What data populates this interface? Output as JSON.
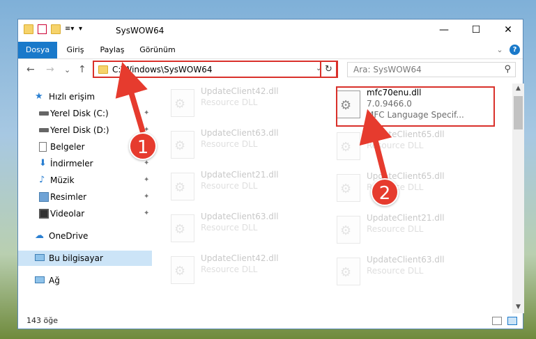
{
  "window": {
    "title": "SysWOW64",
    "minimize_glyph": "—",
    "maximize_glyph": "☐",
    "close_glyph": "✕"
  },
  "ribbon": {
    "tabs": [
      "Dosya",
      "Giriş",
      "Paylaş",
      "Görünüm"
    ],
    "expand_glyph": "⌄",
    "help_glyph": "?"
  },
  "nav": {
    "back_glyph": "←",
    "forward_glyph": "→",
    "recent_glyph": "⌄",
    "up_glyph": "↑",
    "address": "C:\\Windows\\SysWOW64",
    "address_dropdown_glyph": "⌄",
    "refresh_glyph": "↻",
    "search_placeholder": "Ara: SysWOW64",
    "search_glyph": "⚲"
  },
  "sidebar": {
    "items": [
      {
        "label": "Hızlı erişim",
        "icon": "star-icon"
      },
      {
        "label": "Yerel Disk (C:)",
        "icon": "drive-icon",
        "pinned": true
      },
      {
        "label": "Yerel Disk (D:)",
        "icon": "drive-icon",
        "pinned": true
      },
      {
        "label": "Belgeler",
        "icon": "documents-icon",
        "pinned": true
      },
      {
        "label": "İndirmeler",
        "icon": "download-icon",
        "pinned": true
      },
      {
        "label": "Müzik",
        "icon": "music-icon",
        "pinned": true
      },
      {
        "label": "Resimler",
        "icon": "pictures-icon",
        "pinned": true
      },
      {
        "label": "Videolar",
        "icon": "videos-icon",
        "pinned": true
      },
      {
        "label": "OneDrive",
        "icon": "cloud-icon"
      },
      {
        "label": "Bu bilgisayar",
        "icon": "computer-icon"
      },
      {
        "label": "Ağ",
        "icon": "network-icon"
      }
    ],
    "pin_glyph": "📌"
  },
  "files": {
    "highlighted": {
      "name": "mfc70enu.dll",
      "version": "7.0.9466.0",
      "description": "MFC Language Specif..."
    },
    "left_column": [
      {
        "name": "UpdateClient42.dll",
        "type": "Resource DLL"
      },
      {
        "name": "UpdateClient63.dll",
        "type": "Resource DLL"
      },
      {
        "name": "UpdateClient21.dll",
        "type": "Resource DLL"
      },
      {
        "name": "UpdateClient63.dll",
        "type": "Resource DLL"
      },
      {
        "name": "UpdateClient42.dll",
        "type": "Resource DLL"
      }
    ],
    "right_column": [
      {
        "name": "UpdateClient65.dll",
        "type": "Resource DLL"
      },
      {
        "name": "UpdateClient65.dll",
        "type": "Resource DLL"
      },
      {
        "name": "UpdateClient21.dll",
        "type": "Resource DLL"
      },
      {
        "name": "UpdateClient63.dll",
        "type": "Resource DLL"
      }
    ]
  },
  "status": {
    "item_count": "143 öğe"
  },
  "annotations": {
    "marker1": "1",
    "marker2": "2",
    "color": "#e63b2e"
  }
}
